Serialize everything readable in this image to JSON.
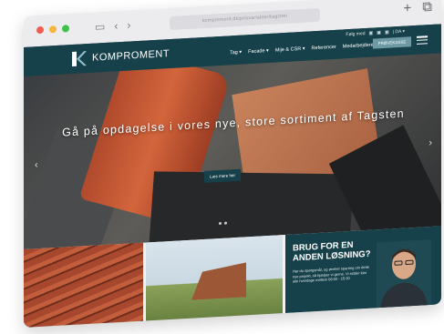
{
  "browser": {
    "url": "kompromont.dk/prisvariabler/tagsten",
    "nav_back": "‹",
    "nav_forward": "›",
    "add_tab": "+",
    "tabs_overview": "⧉"
  },
  "site": {
    "topline": [
      "Følg med",
      "▣",
      "▣",
      "▣",
      "| DA ▾"
    ],
    "logo_text": "KOMPROMENT",
    "menu": [
      "Tag ▾",
      "Facade ▾",
      "Mije & CSR ▾",
      "Referencer",
      "Medarbejdere"
    ],
    "cta_label": "PRØVEKASSE"
  },
  "hero": {
    "title": "Gå på opdagelse i vores nye, store sortiment af Tagsten",
    "button_label": "Læs mere her"
  },
  "help_card": {
    "title": "BRUG FOR EN ANDEN LØSNING?",
    "text": "Har du spørgsmål, og ønsker sparring om dette nye projekt, så hjælper vi gerne. Vi sidder klar alle hverdage mellem 08:00 - 15:30"
  },
  "colors": {
    "brand": "#17414a",
    "cta": "#6d9aa3",
    "tile": "#c35e3c"
  }
}
